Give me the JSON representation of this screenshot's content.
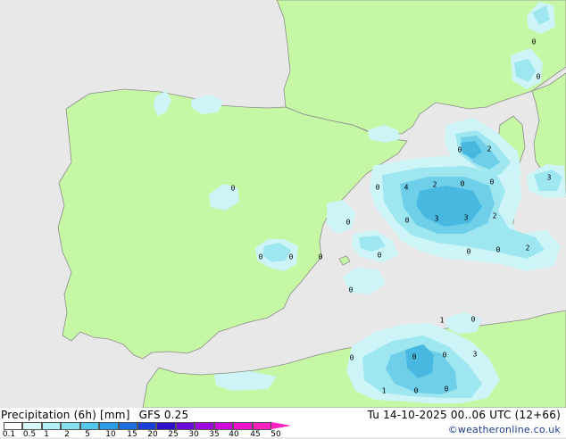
{
  "title": "Precipitation (6h) [mm]",
  "model": "GFS 0.25",
  "valid_time": "Tu 14-10-2025 00..06 UTC (12+66)",
  "credit": "©weatheronline.co.uk",
  "colors": {
    "sea": "#e8e8e8",
    "land": "#c6f7a4",
    "coast": "#8c8c8c",
    "rain_light": "#cdf5f8",
    "rain_mid": "#9ee6f0",
    "rain_heavy": "#6fcfe8",
    "rain_core": "#48b8e0"
  },
  "legend": {
    "ticks": [
      "0.1",
      "0.5",
      "1",
      "2",
      "5",
      "10",
      "15",
      "20",
      "25",
      "30",
      "35",
      "40",
      "45",
      "50"
    ],
    "swatches": [
      "#ffffff",
      "#d8f8fa",
      "#b0f0f6",
      "#84e2f0",
      "#52c8ea",
      "#2b9ce6",
      "#1a6ee0",
      "#1840d8",
      "#3010c8",
      "#6a0ad8",
      "#a008e0",
      "#d008e0",
      "#f010d0",
      "#ff20c0"
    ]
  },
  "labels": [
    {
      "text": "0"
    },
    {
      "text": "0"
    },
    {
      "text": "0"
    },
    {
      "text": "0"
    },
    {
      "text": "2"
    },
    {
      "text": "3"
    },
    {
      "text": "0"
    },
    {
      "text": "4"
    },
    {
      "text": "2"
    },
    {
      "text": "0"
    },
    {
      "text": "0"
    },
    {
      "text": "0"
    },
    {
      "text": "3"
    },
    {
      "text": "3"
    },
    {
      "text": "2"
    },
    {
      "text": "0"
    },
    {
      "text": "0"
    },
    {
      "text": "0"
    },
    {
      "text": "0"
    },
    {
      "text": "0"
    },
    {
      "text": "0"
    },
    {
      "text": "0"
    },
    {
      "text": "0"
    },
    {
      "text": "2"
    },
    {
      "text": "1"
    },
    {
      "text": "0"
    },
    {
      "text": "0"
    },
    {
      "text": "0"
    },
    {
      "text": "0"
    },
    {
      "text": "3"
    },
    {
      "text": "1"
    },
    {
      "text": "0"
    },
    {
      "text": "0"
    },
    {
      "text": "1"
    },
    {
      "text": "2"
    },
    {
      "text": "2"
    },
    {
      "text": "0"
    }
  ]
}
